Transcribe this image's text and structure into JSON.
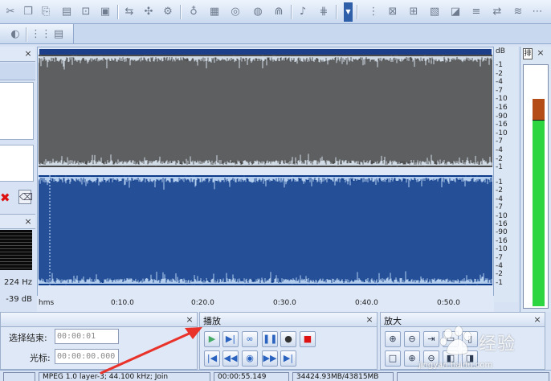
{
  "toolbar": {
    "icons": [
      "cut-icon",
      "copy-icon",
      "paste-icon",
      "mix-paste-icon",
      "crop-icon",
      "select-icon",
      "trim-icon",
      "zoom-icon",
      "metronome-icon",
      "save-icon",
      "cd-icon",
      "broadcast-icon",
      "chorus-icon",
      "filter-icon",
      "tools-icon"
    ],
    "drop_glyph": "▼"
  },
  "left_panel": {
    "close_glyph": "×",
    "delete_glyph": "✖",
    "trash_glyph": "🗑"
  },
  "meter_left": {
    "freq_readout": "224 Hz",
    "db_readout": "-39 dB"
  },
  "db_scale": {
    "unit": "dB",
    "upper": [
      "-1",
      "-2",
      "-4",
      "-7",
      "-10",
      "-16",
      "-90",
      "-16",
      "-10",
      "-7",
      "-4",
      "-2",
      "-1"
    ],
    "lower": [
      "-1",
      "-2",
      "-4",
      "-7",
      "-10",
      "-16",
      "-90",
      "-16",
      "-10",
      "-7",
      "-4",
      "-2",
      "-1"
    ]
  },
  "time_ruler": {
    "labels": [
      "hms",
      "0:10.0",
      "0:20.0",
      "0:30.0",
      "0:40.0",
      "0:50.0"
    ]
  },
  "level_meter": {
    "head_glyph": "排",
    "peak_fraction": 0.85,
    "level_fraction": 0.76,
    "colors": {
      "peak": "#b44c18",
      "level": "#2dd641"
    }
  },
  "waveform": {
    "colors": {
      "top_bg": "#4a4a4a",
      "bottom_bg": "#0d3b8a",
      "wave_top": "#e8f4ff",
      "wave_bottom": "#cfe6ff"
    }
  },
  "selection_panel": {
    "sel_end_label": "选择结束:",
    "sel_end_value": "00:00:01",
    "cursor_label": "光标:",
    "cursor_value": "00:00:00.000"
  },
  "play_panel": {
    "title": "播放",
    "close_glyph": "×",
    "buttons": [
      {
        "name": "play-button",
        "glyph": "▶"
      },
      {
        "name": "play-to-end-button",
        "glyph": "▶|"
      },
      {
        "name": "loop-button",
        "glyph": "∞"
      },
      {
        "name": "pause-button",
        "glyph": "❚❚"
      },
      {
        "name": "record-button",
        "glyph": "●"
      },
      {
        "name": "stop-button",
        "glyph": "■"
      },
      {
        "name": "go-start-button",
        "glyph": "|◀"
      },
      {
        "name": "rewind-button",
        "glyph": "◀◀"
      },
      {
        "name": "play-cursor-button",
        "glyph": "◉"
      },
      {
        "name": "fast-forward-button",
        "glyph": "▶▶"
      },
      {
        "name": "go-end-button",
        "glyph": "▶|"
      }
    ]
  },
  "zoom_panel": {
    "title": "放大",
    "close_glyph": "×",
    "buttons": [
      {
        "name": "zoom-in-button",
        "glyph": "⊕"
      },
      {
        "name": "zoom-out-button",
        "glyph": "⊖"
      },
      {
        "name": "zoom-selection-button",
        "glyph": "⇥"
      },
      {
        "name": "zoom-fit-button",
        "glyph": "▭"
      },
      {
        "name": "zoom-vertical-button",
        "glyph": "▯"
      },
      {
        "name": "zoom-full-button",
        "glyph": "□"
      },
      {
        "name": "zoom-in-v-button",
        "glyph": "⊕"
      },
      {
        "name": "zoom-out-v-button",
        "glyph": "⊖"
      },
      {
        "name": "zoom-left-button",
        "glyph": "◧"
      },
      {
        "name": "zoom-right-button",
        "glyph": "◨"
      }
    ]
  },
  "status": {
    "format": "MPEG 1.0 layer-3; 44.100 kHz; Join",
    "duration": "00:00:55.149",
    "disk": "34424.93MB/43815MB"
  },
  "watermark": {
    "brand_text": "经验",
    "url": "jingyan.baidu.com"
  }
}
